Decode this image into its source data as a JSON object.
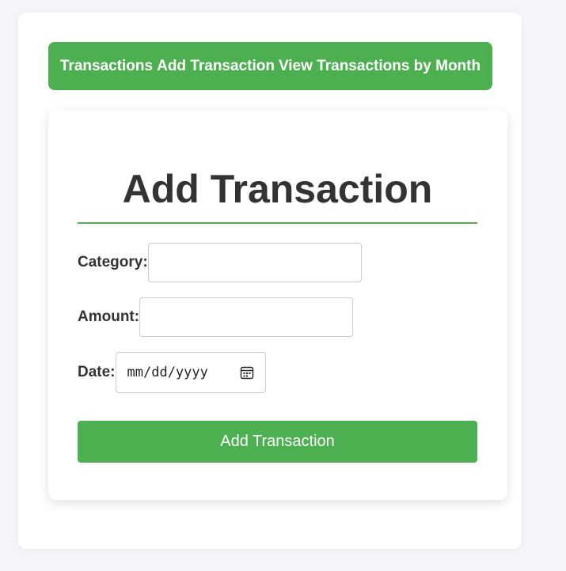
{
  "nav": {
    "items": [
      {
        "label": "Transactions"
      },
      {
        "label": "Add Transaction"
      },
      {
        "label": "View Transactions by Month"
      }
    ]
  },
  "form": {
    "title": "Add Transaction",
    "fields": [
      {
        "label": "Category:",
        "value": ""
      },
      {
        "label": "Amount:",
        "value": ""
      },
      {
        "label": "Date:",
        "placeholder": "mm/dd/yyyy"
      }
    ],
    "submit_label": "Add Transaction"
  },
  "colors": {
    "accent": "#4caf50",
    "text": "#333333",
    "background": "#f4f5f9"
  },
  "icons": {
    "date_picker": "calendar-icon"
  }
}
